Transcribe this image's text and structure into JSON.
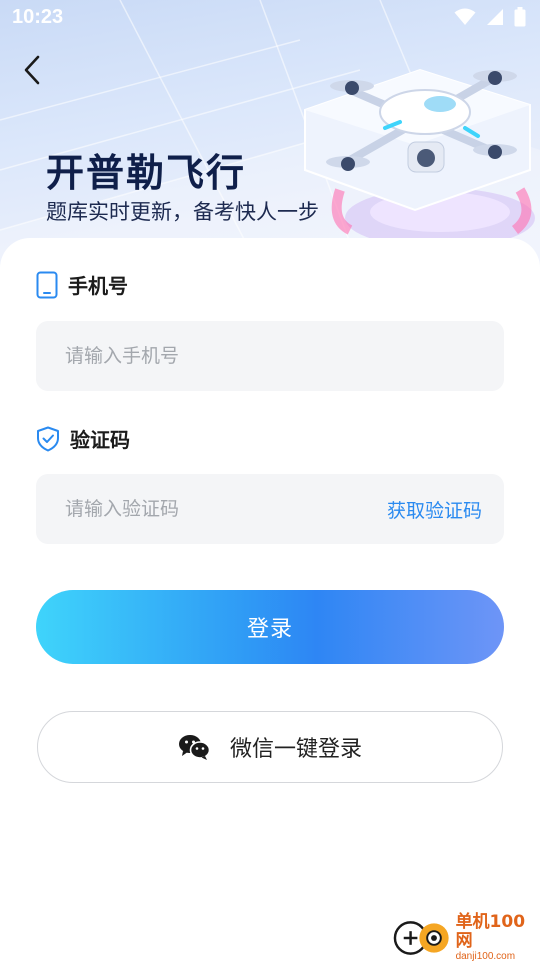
{
  "status_bar": {
    "time": "10:23"
  },
  "header": {
    "title": "开普勒飞行",
    "subtitle": "题库实时更新，备考快人一步"
  },
  "phone": {
    "label": "手机号",
    "placeholder": "请输入手机号",
    "value": ""
  },
  "code": {
    "label": "验证码",
    "placeholder": "请输入验证码",
    "value": "",
    "get_code_label": "获取验证码"
  },
  "login_button": "登录",
  "wechat_button": "微信一键登录",
  "watermark": {
    "cn": "单机100网",
    "en": "danji100.com"
  },
  "icons": {
    "back": "chevron-left-icon",
    "phone": "phone-icon",
    "code": "shield-check-icon",
    "wechat": "wechat-icon"
  },
  "colors": {
    "accent": "#2a8af0",
    "title": "#0f1f4a",
    "input_bg": "#f4f5f7",
    "gradient_start": "#3fd4fb",
    "gradient_end": "#6e95f7"
  }
}
